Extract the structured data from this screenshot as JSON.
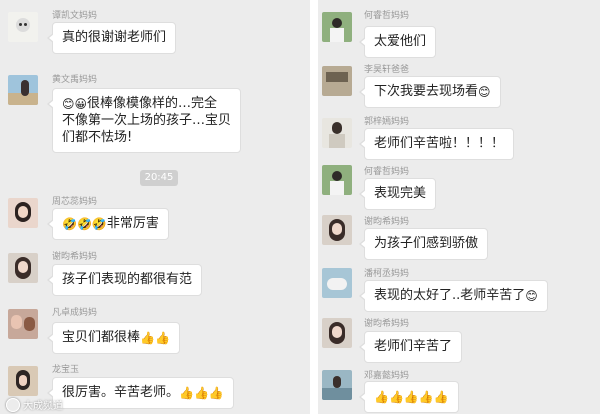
{
  "left": {
    "messages": [
      {
        "name": "谭凯文妈妈",
        "lines": [
          "真的很谢谢老师们"
        ]
      },
      {
        "name": "黄文禹妈妈",
        "lines": [
          "很棒像模像样的…完全",
          "不像第一次上场的孩子…宝贝",
          "们都不怯场!"
        ]
      },
      {
        "name": "周芯蕊妈妈",
        "lines": [
          "非常厉害"
        ]
      },
      {
        "name": "谢昀希妈妈",
        "lines": [
          "孩子们表现的都很有范"
        ]
      },
      {
        "name": "凡卓成妈妈",
        "lines": [
          "宝贝们都很棒"
        ]
      },
      {
        "name": "龙宝玉",
        "lines": [
          "很厉害。辛苦老师。"
        ]
      }
    ],
    "time": "20:45"
  },
  "right": {
    "messages": [
      {
        "name": "何睿哲妈妈",
        "lines": [
          "太爱他们"
        ]
      },
      {
        "name": "李昊轩爸爸",
        "lines": [
          "下次我要去现场看"
        ]
      },
      {
        "name": "郭梓嫣妈妈",
        "lines": [
          "老师们辛苦啦！！！！"
        ]
      },
      {
        "name": "何睿哲妈妈",
        "lines": [
          "表现完美"
        ]
      },
      {
        "name": "谢昀希妈妈",
        "lines": [
          "为孩子们感到骄傲"
        ]
      },
      {
        "name": "潘柯丞妈妈",
        "lines": [
          "表现的太好了..老师辛苦了"
        ]
      },
      {
        "name": "谢昀希妈妈",
        "lines": [
          "老师们辛苦了"
        ]
      },
      {
        "name": "邓嘉懿妈妈",
        "lines": [
          ""
        ]
      }
    ]
  },
  "icons": {
    "smile": "😊",
    "grin": "😀",
    "cry_laugh": "🤣",
    "thumbs_up": "👍"
  },
  "watermark": "大成频道"
}
